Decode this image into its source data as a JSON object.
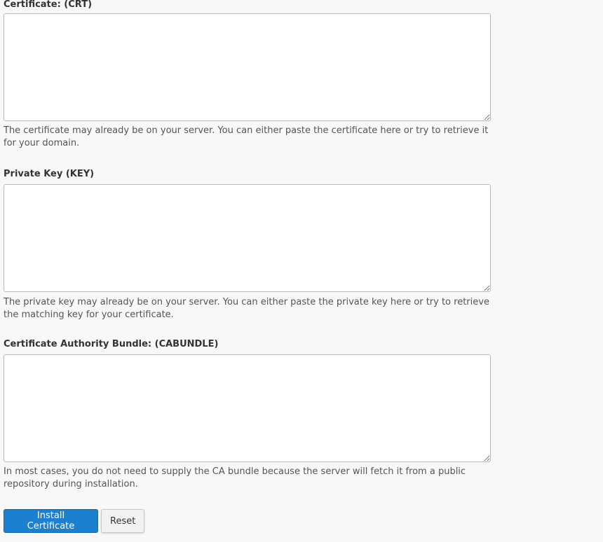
{
  "certificate": {
    "label": "Certificate: (CRT)",
    "value": "",
    "help": "The certificate may already be on your server. You can either paste the certificate here or try to retrieve it for your domain."
  },
  "private_key": {
    "label": "Private Key (KEY)",
    "value": "",
    "help": "The private key may already be on your server. You can either paste the private key here or try to retrieve the matching key for your certificate."
  },
  "ca_bundle": {
    "label": "Certificate Authority Bundle: (CABUNDLE)",
    "value": "",
    "help": "In most cases, you do not need to supply the CA bundle because the server will fetch it from a public repository during installation."
  },
  "actions": {
    "install_label": "Install Certificate",
    "reset_label": "Reset"
  },
  "colors": {
    "primary": "#1b80cf",
    "background": "#f8f8f8"
  }
}
